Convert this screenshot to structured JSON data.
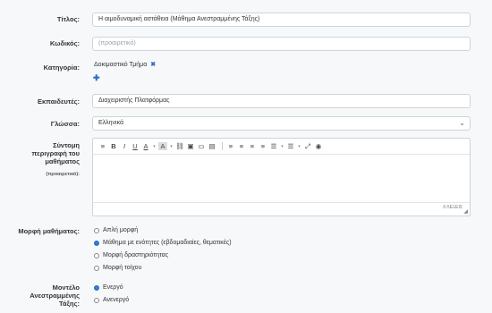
{
  "form": {
    "title_label": "Τίτλος:",
    "title_value": "Η αιμοδυναμική αστάθεια (Μάθημα Ανεστραμμένης Τάξης)",
    "code_label": "Κωδικός:",
    "code_placeholder": "(προαιρετικό)",
    "category_label": "Κατηγορία:",
    "category_value": "Δοκιμαστικό Τμήμα",
    "category_remove_glyph": "✖",
    "category_add_glyph": "✚",
    "instructor_label": "Εκπαιδευτές:",
    "instructor_value": "Διαχειριστής Πλατφόρμας",
    "language_label": "Γλώσσα:",
    "language_value": "Ελληνικά",
    "description_label": "Σύντομη περιγραφή του μαθήματος",
    "description_hint": "(προαιρετικό):",
    "words_count": "0 ΛΕΞΕΙΣ",
    "format_label": "Μορφή μαθήματος:",
    "format_options": [
      {
        "label": "Απλή μορφή",
        "selected": false
      },
      {
        "label": "Μάθημα με ενότητες (εβδομαδιαίες, θεματικές)",
        "selected": true
      },
      {
        "label": "Μορφή δραστηριότητας",
        "selected": false
      },
      {
        "label": "Μορφή τοίχου",
        "selected": false
      }
    ],
    "flipped_label": "Μοντέλο Ανεστραμμένης Τάξης:",
    "flipped_options": [
      {
        "label": "Ενεργό",
        "selected": true
      },
      {
        "label": "Ανενεργό",
        "selected": false
      }
    ]
  },
  "toolbar": {
    "items": [
      "≡",
      "B",
      "I",
      "U",
      "A",
      "A",
      "🔗",
      "▣",
      "▭",
      "▤",
      "≡",
      "≡",
      "≡",
      "≡",
      "☰",
      "☰",
      "⤢",
      "👁"
    ]
  },
  "colors": {
    "accent": "#2a6fc9",
    "border": "#cfd4da",
    "background": "#f7f8fa"
  }
}
